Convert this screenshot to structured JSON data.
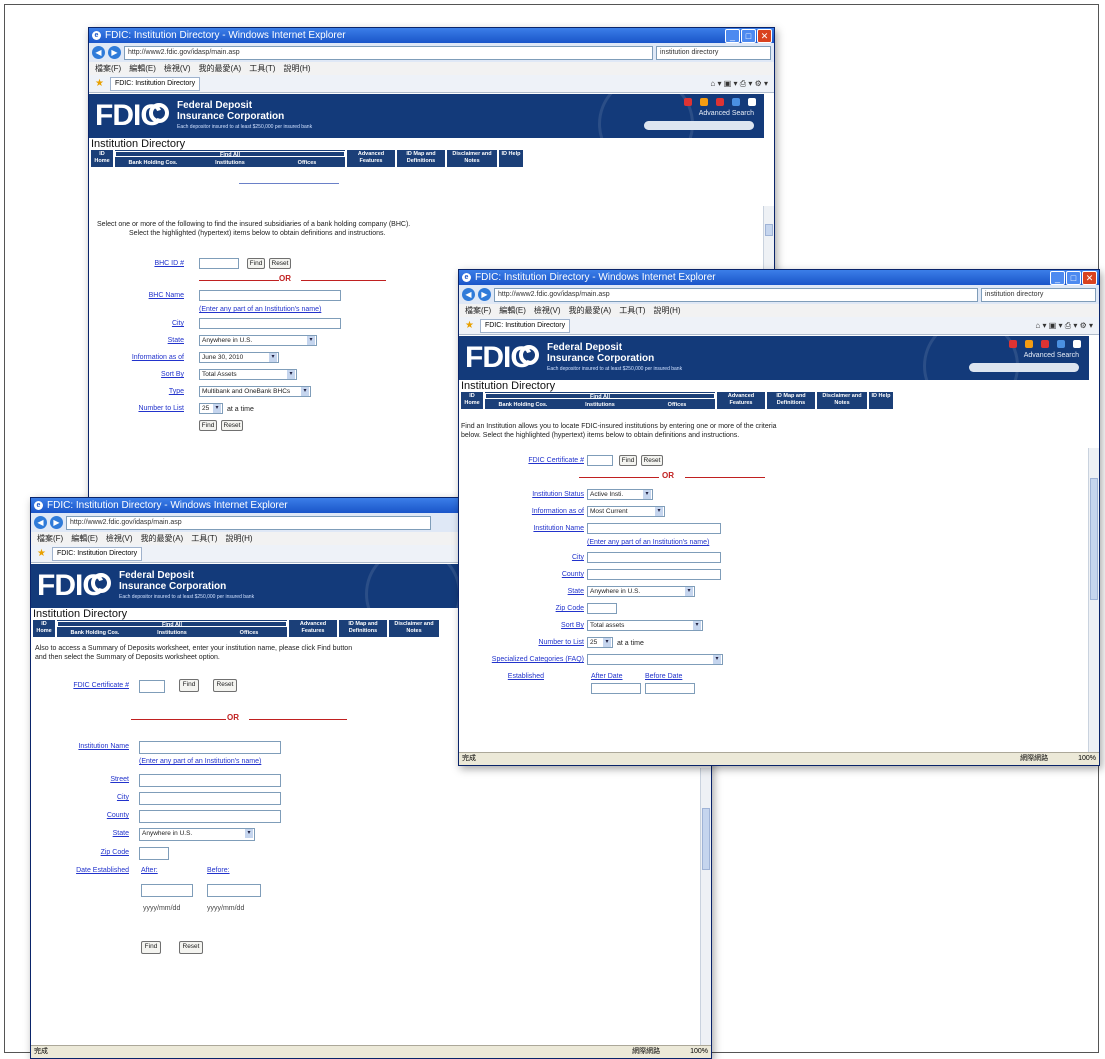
{
  "common": {
    "org_line1": "Federal Deposit",
    "org_line2": "Insurance Corporation",
    "tagline": "Each depositor insured to at least $250,000 per insured bank",
    "logo": "FDIC",
    "advanced_search": "Advanced Search",
    "directory_title": "Institution Directory",
    "nav": {
      "id_home": "ID Home",
      "find_all": "Find All",
      "bhc": "Bank Holding Cos.",
      "institutions": "Institutions",
      "offices": "Offices",
      "advanced": "Advanced Features",
      "idmap": "ID Map and Definitions",
      "disclaimer": "Disclaimer and Notes",
      "help": "ID Help"
    },
    "find_btn": "Find",
    "reset_btn": "Reset",
    "or": "OR",
    "partial_hint": "(Enter any part of an Institution's name)",
    "status_left": "完成",
    "zone": "網際網路",
    "zoom": "100%"
  },
  "win1": {
    "title": "FDIC: Institution Directory - Windows Internet Explorer",
    "url": "http://www2.fdic.gov/idasp/main.asp",
    "search": "institution directory",
    "tab": "FDIC: Institution Directory",
    "menus": [
      "檔案(F)",
      "編輯(E)",
      "檢視(V)",
      "我的最愛(A)",
      "工具(T)",
      "說明(H)"
    ],
    "intro1": "Select one or more of the following to find the insured subsidiaries of a bank holding company (BHC).",
    "intro2": "Select the highlighted (hypertext) items below to obtain definitions and instructions.",
    "bhc_id_label": "BHC ID #",
    "bhc_name_label": "BHC Name",
    "city_label": "City",
    "state_label": "State",
    "state_value": "Anywhere in U.S.",
    "info_label": "Information as of",
    "info_value": "June 30, 2010",
    "sortby_label": "Sort By",
    "sortby_value": "Total Assets",
    "type_label": "Type",
    "type_value": "Multibank and OneBank BHCs",
    "number_label": "Number to List",
    "number_value": "25",
    "at_a_time": "at a time"
  },
  "win2": {
    "title": "FDIC: Institution Directory - Windows Internet Explorer",
    "url": "http://www2.fdic.gov/idasp/main.asp",
    "search": "institution directory",
    "tab": "FDIC: Institution Directory",
    "menus": [
      "檔案(F)",
      "編輯(E)",
      "檢視(V)",
      "我的最愛(A)",
      "工具(T)",
      "說明(H)"
    ],
    "intro1": "Find an Institution allows you to locate FDIC-insured institutions by entering one or more of the criteria",
    "intro2": "below. Select the highlighted (hypertext) items below to obtain definitions and instructions.",
    "cert_label": "FDIC Certificate #",
    "status_label": "Institution Status",
    "status_value": "Active Insti.",
    "info_label": "Information as of",
    "info_value": "Most Current",
    "name_label": "Institution Name",
    "city_label": "City",
    "county_label": "County",
    "state_label": "State",
    "state_value": "Anywhere in U.S.",
    "zip_label": "Zip Code",
    "sortby_label": "Sort By",
    "sortby_value": "Total assets",
    "number_label": "Number to List",
    "number_value": "25",
    "at_a_time": "at a time",
    "special_label": "Specialized Categories (FAQ)",
    "established_label": "Established",
    "after_label": "After Date",
    "before_label": "Before Date"
  },
  "win3": {
    "title": "FDIC: Institution Directory - Windows Internet Explorer",
    "url": "http://www2.fdic.gov/idasp/main.asp",
    "tab": "FDIC: Institution Directory",
    "menus": [
      "檔案(F)",
      "編輯(E)",
      "檢視(V)",
      "我的最愛(A)",
      "工具(T)",
      "說明(H)"
    ],
    "intro1": "Also to access a Summary of Deposits worksheet, enter your institution name, please click Find button",
    "intro2": "and then select the Summary of Deposits worksheet option.",
    "cert_label": "FDIC Certificate #",
    "name_label": "Institution Name",
    "street_label": "Street",
    "city_label": "City",
    "county_label": "County",
    "state_label": "State",
    "state_value": "Anywhere in U.S.",
    "zip_label": "Zip Code",
    "date_label": "Date Established",
    "after_label": "After:",
    "before_label": "Before:",
    "date_fmt": "yyyy/mm/dd"
  }
}
